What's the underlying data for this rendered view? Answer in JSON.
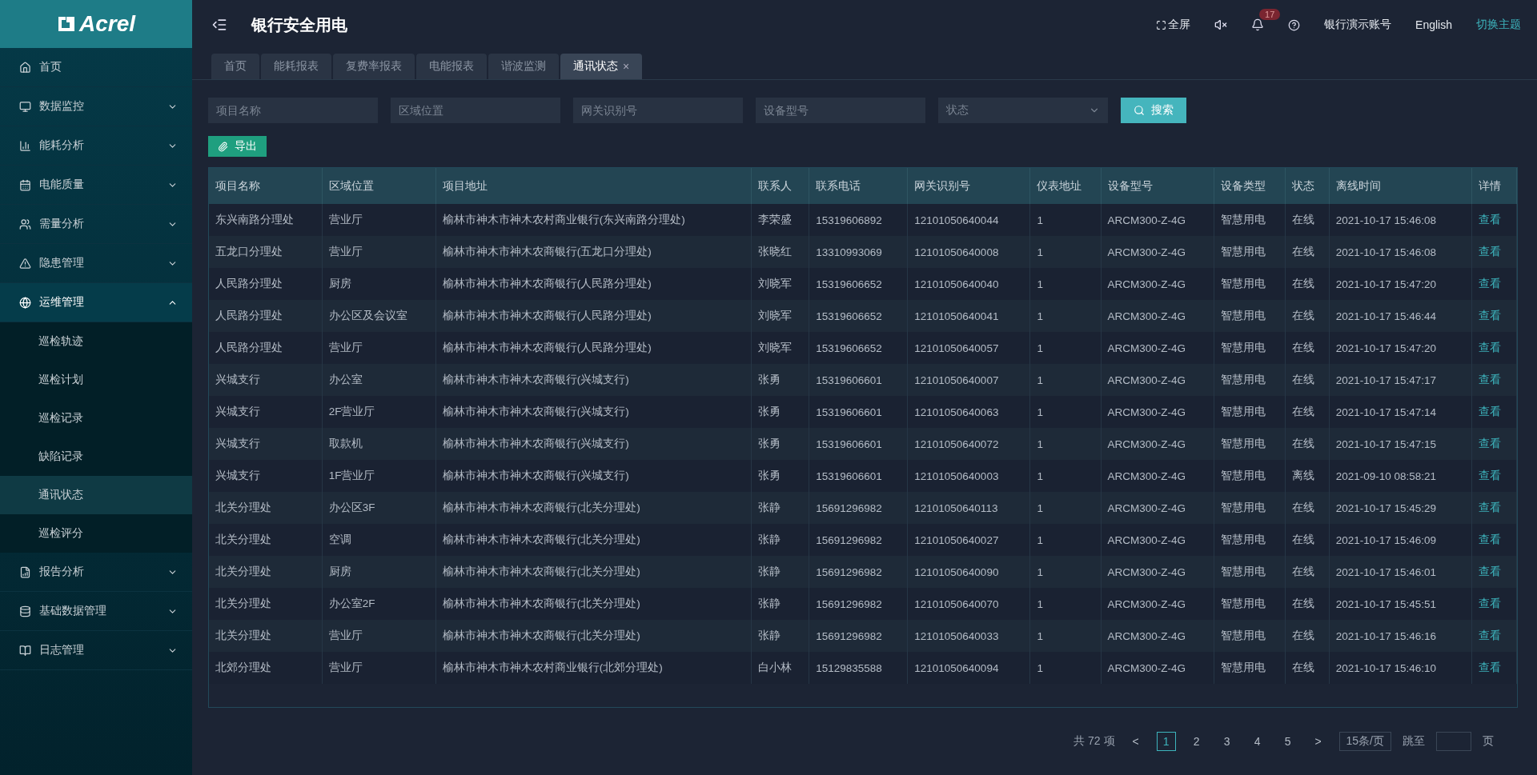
{
  "logo": {
    "text": "Acrel"
  },
  "header": {
    "title": "银行安全用电",
    "fullscreen": "全屏",
    "notifications": "17",
    "account": "银行演示账号",
    "language": "English",
    "theme_switch": "切换主题"
  },
  "sidebar": {
    "items": [
      {
        "label": "首页",
        "kind": "link",
        "expanded": false
      },
      {
        "label": "数据监控",
        "kind": "group",
        "expanded": false
      },
      {
        "label": "能耗分析",
        "kind": "group",
        "expanded": false
      },
      {
        "label": "电能质量",
        "kind": "group",
        "expanded": false
      },
      {
        "label": "需量分析",
        "kind": "group",
        "expanded": false
      },
      {
        "label": "隐患管理",
        "kind": "group",
        "expanded": false
      },
      {
        "label": "运维管理",
        "kind": "group",
        "expanded": true,
        "children": [
          {
            "label": "巡检轨迹",
            "selected": false
          },
          {
            "label": "巡检计划",
            "selected": false
          },
          {
            "label": "巡检记录",
            "selected": false
          },
          {
            "label": "缺陷记录",
            "selected": false
          },
          {
            "label": "通讯状态",
            "selected": true
          },
          {
            "label": "巡检评分",
            "selected": false
          }
        ]
      },
      {
        "label": "报告分析",
        "kind": "group",
        "expanded": false
      },
      {
        "label": "基础数据管理",
        "kind": "group",
        "expanded": false
      },
      {
        "label": "日志管理",
        "kind": "group",
        "expanded": false
      }
    ]
  },
  "tabs": [
    {
      "label": "首页",
      "selected": false,
      "closable": false
    },
    {
      "label": "能耗报表",
      "selected": false,
      "closable": false
    },
    {
      "label": "复费率报表",
      "selected": false,
      "closable": false
    },
    {
      "label": "电能报表",
      "selected": false,
      "closable": false
    },
    {
      "label": "谐波监测",
      "selected": false,
      "closable": false
    },
    {
      "label": "通讯状态",
      "selected": true,
      "closable": true,
      "close": "×"
    }
  ],
  "filters": [
    {
      "placeholder": "项目名称",
      "kind": "input"
    },
    {
      "placeholder": "区域位置",
      "kind": "input"
    },
    {
      "placeholder": "网关识别号",
      "kind": "input"
    },
    {
      "placeholder": "设备型号",
      "kind": "input"
    },
    {
      "placeholder": "状态",
      "kind": "select"
    }
  ],
  "search_button": "搜索",
  "export_button": "导出",
  "table": {
    "columns": [
      "项目名称",
      "区域位置",
      "项目地址",
      "联系人",
      "联系电话",
      "网关识别号",
      "仪表地址",
      "设备型号",
      "设备类型",
      "状态",
      "离线时间",
      "详情"
    ],
    "rows": [
      [
        "东兴南路分理处",
        "营业厅",
        "榆林市神木市神木农村商业银行(东兴南路分理处)",
        "李荣盛",
        "15319606892",
        "12101050640044",
        "1",
        "ARCM300-Z-4G",
        "智慧用电",
        "在线",
        "2021-10-17 15:46:08",
        "查看"
      ],
      [
        "五龙口分理处",
        "营业厅",
        "榆林市神木市神木农商银行(五龙口分理处)",
        "张晓红",
        "13310993069",
        "12101050640008",
        "1",
        "ARCM300-Z-4G",
        "智慧用电",
        "在线",
        "2021-10-17 15:46:08",
        "查看"
      ],
      [
        "人民路分理处",
        "厨房",
        "榆林市神木市神木农商银行(人民路分理处)",
        "刘晓军",
        "15319606652",
        "12101050640040",
        "1",
        "ARCM300-Z-4G",
        "智慧用电",
        "在线",
        "2021-10-17 15:47:20",
        "查看"
      ],
      [
        "人民路分理处",
        "办公区及会议室",
        "榆林市神木市神木农商银行(人民路分理处)",
        "刘晓军",
        "15319606652",
        "12101050640041",
        "1",
        "ARCM300-Z-4G",
        "智慧用电",
        "在线",
        "2021-10-17 15:46:44",
        "查看"
      ],
      [
        "人民路分理处",
        "营业厅",
        "榆林市神木市神木农商银行(人民路分理处)",
        "刘晓军",
        "15319606652",
        "12101050640057",
        "1",
        "ARCM300-Z-4G",
        "智慧用电",
        "在线",
        "2021-10-17 15:47:20",
        "查看"
      ],
      [
        "兴城支行",
        "办公室",
        "榆林市神木市神木农商银行(兴城支行)",
        "张勇",
        "15319606601",
        "12101050640007",
        "1",
        "ARCM300-Z-4G",
        "智慧用电",
        "在线",
        "2021-10-17 15:47:17",
        "查看"
      ],
      [
        "兴城支行",
        "2F营业厅",
        "榆林市神木市神木农商银行(兴城支行)",
        "张勇",
        "15319606601",
        "12101050640063",
        "1",
        "ARCM300-Z-4G",
        "智慧用电",
        "在线",
        "2021-10-17 15:47:14",
        "查看"
      ],
      [
        "兴城支行",
        "取款机",
        "榆林市神木市神木农商银行(兴城支行)",
        "张勇",
        "15319606601",
        "12101050640072",
        "1",
        "ARCM300-Z-4G",
        "智慧用电",
        "在线",
        "2021-10-17 15:47:15",
        "查看"
      ],
      [
        "兴城支行",
        "1F营业厅",
        "榆林市神木市神木农商银行(兴城支行)",
        "张勇",
        "15319606601",
        "12101050640003",
        "1",
        "ARCM300-Z-4G",
        "智慧用电",
        "离线",
        "2021-09-10 08:58:21",
        "查看"
      ],
      [
        "北关分理处",
        "办公区3F",
        "榆林市神木市神木农商银行(北关分理处)",
        "张静",
        "15691296982",
        "12101050640113",
        "1",
        "ARCM300-Z-4G",
        "智慧用电",
        "在线",
        "2021-10-17 15:45:29",
        "查看"
      ],
      [
        "北关分理处",
        "空调",
        "榆林市神木市神木农商银行(北关分理处)",
        "张静",
        "15691296982",
        "12101050640027",
        "1",
        "ARCM300-Z-4G",
        "智慧用电",
        "在线",
        "2021-10-17 15:46:09",
        "查看"
      ],
      [
        "北关分理处",
        "厨房",
        "榆林市神木市神木农商银行(北关分理处)",
        "张静",
        "15691296982",
        "12101050640090",
        "1",
        "ARCM300-Z-4G",
        "智慧用电",
        "在线",
        "2021-10-17 15:46:01",
        "查看"
      ],
      [
        "北关分理处",
        "办公室2F",
        "榆林市神木市神木农商银行(北关分理处)",
        "张静",
        "15691296982",
        "12101050640070",
        "1",
        "ARCM300-Z-4G",
        "智慧用电",
        "在线",
        "2021-10-17 15:45:51",
        "查看"
      ],
      [
        "北关分理处",
        "营业厅",
        "榆林市神木市神木农商银行(北关分理处)",
        "张静",
        "15691296982",
        "12101050640033",
        "1",
        "ARCM300-Z-4G",
        "智慧用电",
        "在线",
        "2021-10-17 15:46:16",
        "查看"
      ],
      [
        "北郊分理处",
        "营业厅",
        "榆林市神木市神木农村商业银行(北郊分理处)",
        "白小林",
        "15129835588",
        "12101050640094",
        "1",
        "ARCM300-Z-4G",
        "智慧用电",
        "在线",
        "2021-10-17 15:46:10",
        "查看"
      ]
    ]
  },
  "pagination": {
    "total": "共 72 项",
    "prev": "<",
    "pages": [
      {
        "label": "1",
        "selected": true
      },
      {
        "label": "2",
        "selected": false
      },
      {
        "label": "3",
        "selected": false
      },
      {
        "label": "4",
        "selected": false
      },
      {
        "label": "5",
        "selected": false
      }
    ],
    "next": ">",
    "page_size": "15条/页",
    "jump_label": "跳至",
    "jump_suffix": "页"
  }
}
